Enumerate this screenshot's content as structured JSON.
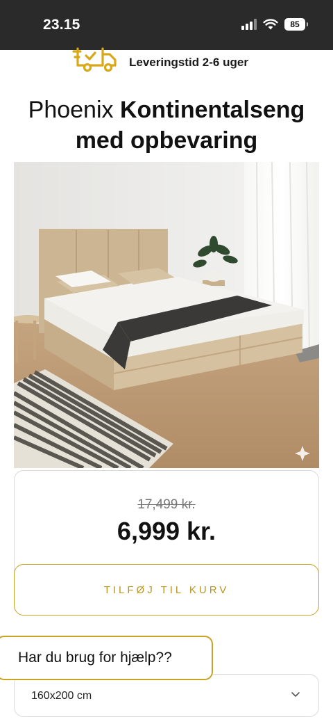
{
  "status_bar": {
    "time": "23.15",
    "battery": "85"
  },
  "delivery": {
    "icon": "truck-icon",
    "text": "Leveringstid 2-6 uger"
  },
  "product": {
    "title_light": "Phoenix",
    "title_bold_1": "Kontinentalseng",
    "title_bold_2": "med opbevaring",
    "image": "bed-photo"
  },
  "price": {
    "old": "17,499 kr.",
    "current": "6,999 kr."
  },
  "cart": {
    "add_label": "TILFØJ TIL KURV"
  },
  "help": {
    "label": "Har du brug for hjælp??"
  },
  "size_select": {
    "value": "160x200 cm"
  },
  "colors": {
    "accent": "#c9a227",
    "status_bar": "#2a2a2a"
  }
}
